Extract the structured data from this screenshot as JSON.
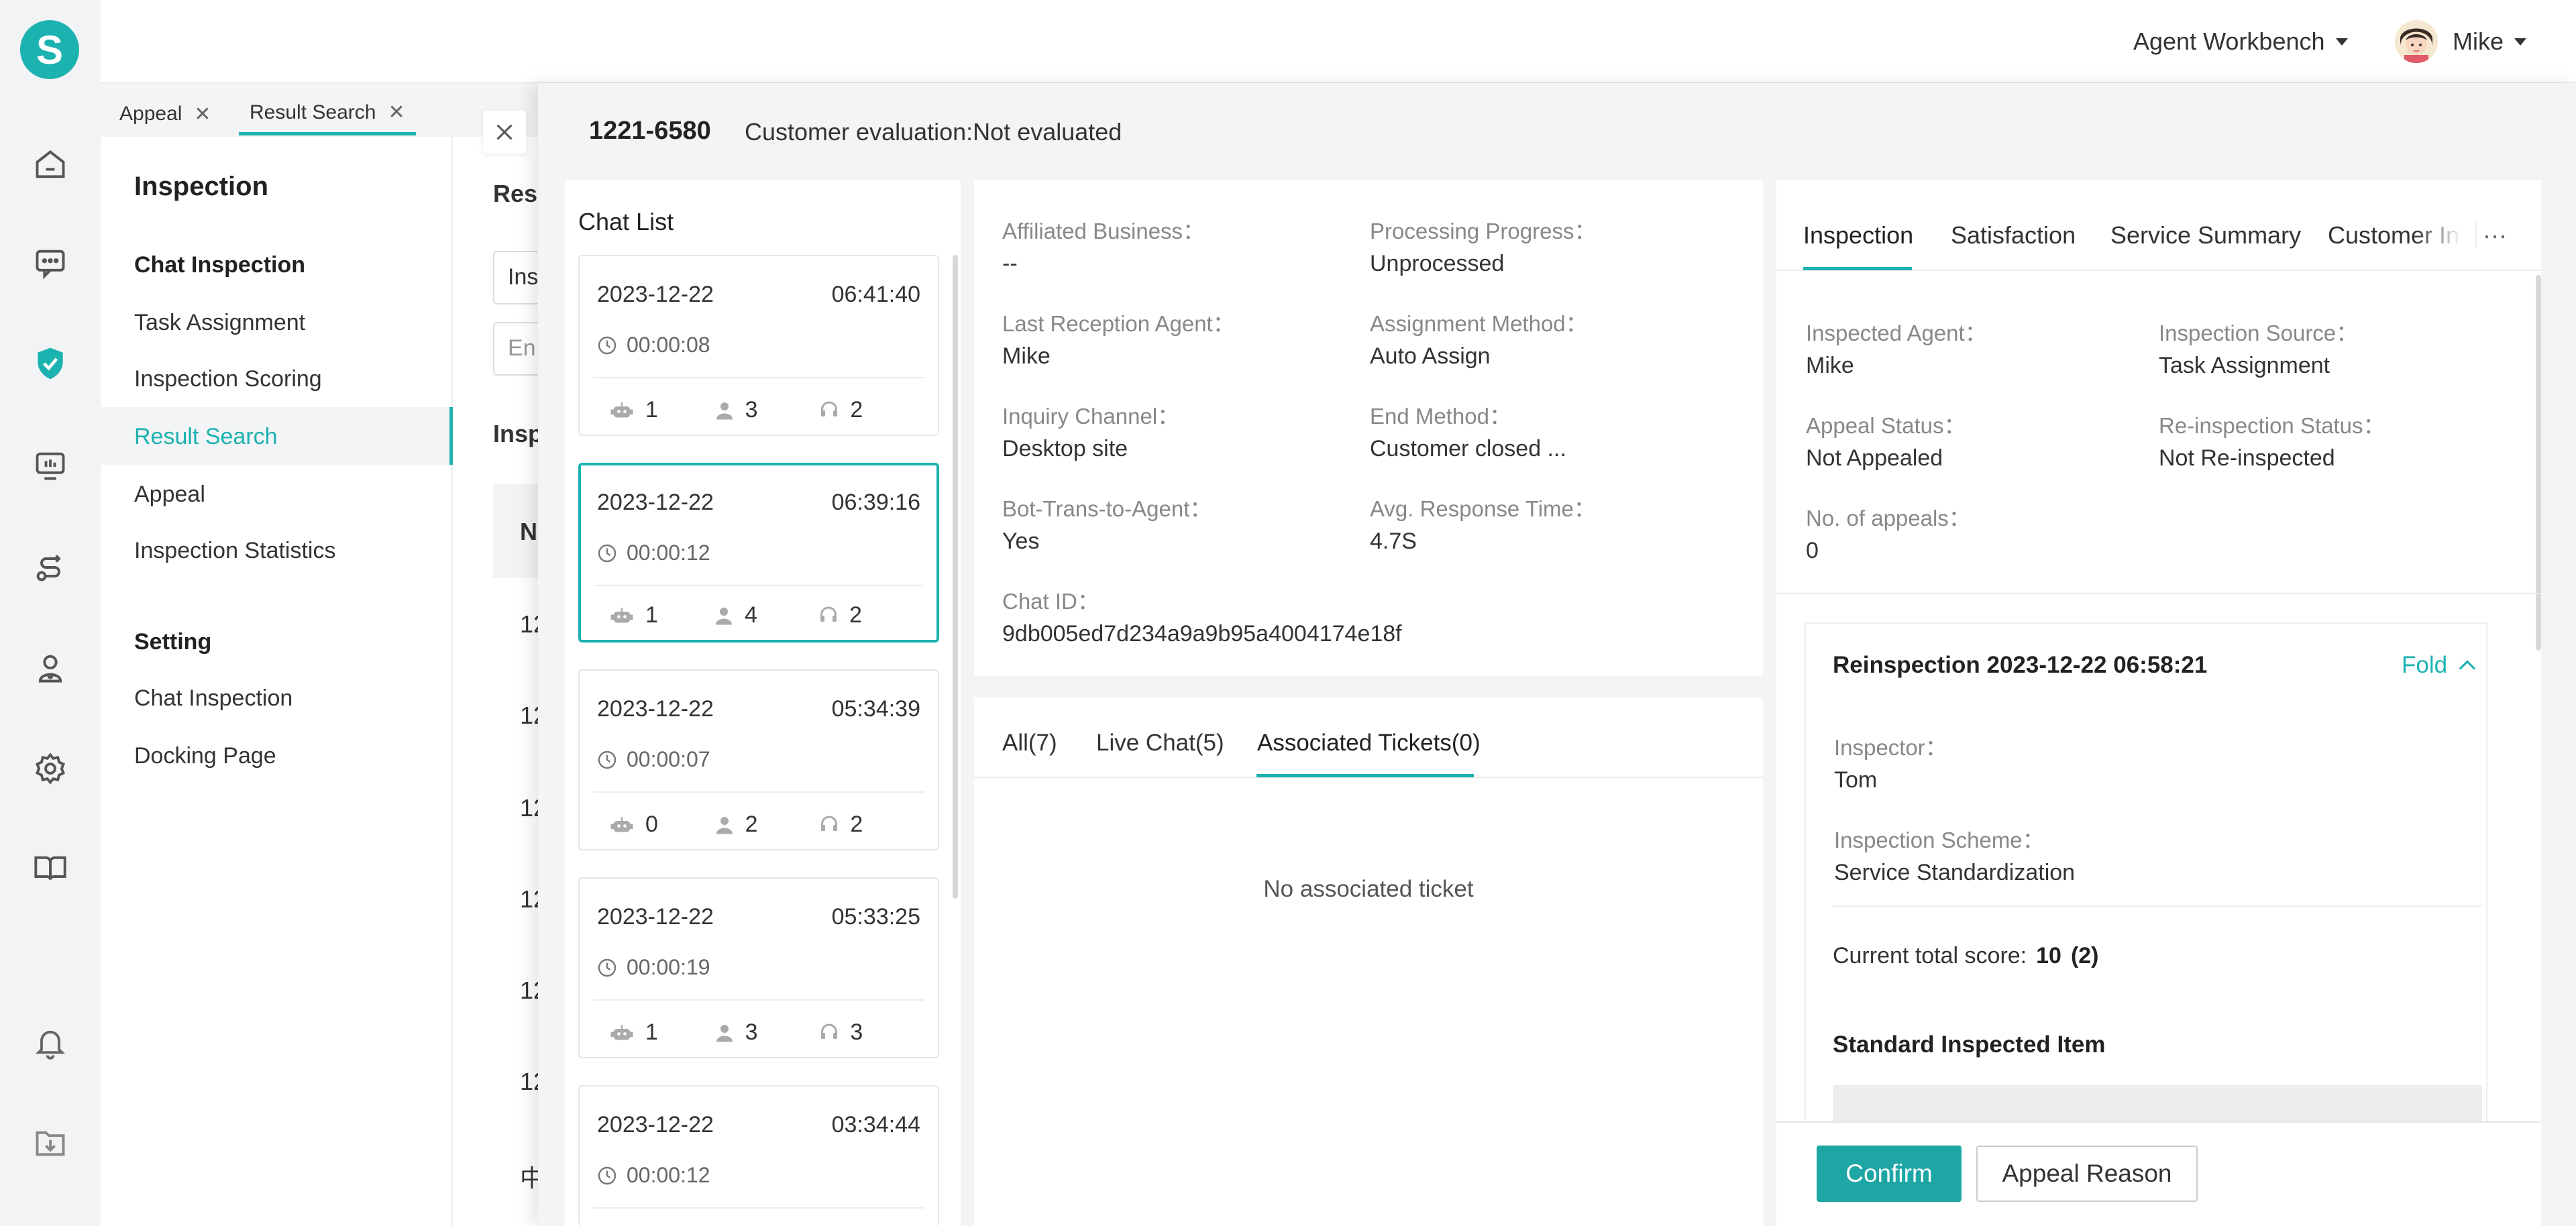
{
  "header": {
    "workbench_label": "Agent Workbench",
    "user_name": "Mike"
  },
  "tabs": [
    {
      "label": "Appeal"
    },
    {
      "label": "Result Search"
    }
  ],
  "sidenav": {
    "title": "Inspection",
    "section1": "Chat Inspection",
    "items1": [
      "Task Assignment",
      "Inspection Scoring",
      "Result Search",
      "Appeal",
      "Inspection Statistics"
    ],
    "section2": "Setting",
    "items2": [
      "Chat Inspection",
      "Docking Page"
    ]
  },
  "bg_page": {
    "title_frag": "Resu",
    "input1_frag": "Ins",
    "input2_frag": "En",
    "section_frag": "Insp",
    "thead_frag": "N",
    "rows": [
      "12",
      "12",
      "12",
      "12",
      "12",
      "12",
      "中"
    ]
  },
  "drawer": {
    "conv_id": "1221-6580",
    "customer_eval": "Customer evaluation:Not evaluated",
    "chat_list_title": "Chat List",
    "chats": [
      {
        "date": "2023-12-22",
        "time": "06:41:40",
        "duration": "00:00:08",
        "bot": "1",
        "visitor": "3",
        "agent": "2"
      },
      {
        "date": "2023-12-22",
        "time": "06:39:16",
        "duration": "00:00:12",
        "bot": "1",
        "visitor": "4",
        "agent": "2"
      },
      {
        "date": "2023-12-22",
        "time": "05:34:39",
        "duration": "00:00:07",
        "bot": "0",
        "visitor": "2",
        "agent": "2"
      },
      {
        "date": "2023-12-22",
        "time": "05:33:25",
        "duration": "00:00:19",
        "bot": "1",
        "visitor": "3",
        "agent": "3"
      },
      {
        "date": "2023-12-22",
        "time": "03:34:44",
        "duration": "00:00:12",
        "bot": "",
        "visitor": "",
        "agent": ""
      }
    ]
  },
  "biz": {
    "affiliated_business_label": "Affiliated Business：",
    "affiliated_business": "--",
    "processing_progress_label": "Processing Progress：",
    "processing_progress": "Unprocessed",
    "last_agent_label": "Last Reception Agent：",
    "last_agent": "Mike",
    "assign_method_label": "Assignment Method：",
    "assign_method": "Auto Assign",
    "inquiry_channel_label": "Inquiry Channel：",
    "inquiry_channel": "Desktop site",
    "end_method_label": "End Method：",
    "end_method": "Customer closed ...",
    "bot_trans_label": "Bot-Trans-to-Agent：",
    "bot_trans": "Yes",
    "avg_resp_label": "Avg. Response Time：",
    "avg_resp": "4.7S",
    "chat_id_label": "Chat ID：",
    "chat_id": "9db005ed7d234a9a9b95a4004174e18f"
  },
  "tickets": {
    "tabs": [
      "All(7)",
      "Live Chat(5)",
      "Associated Tickets(0)"
    ],
    "empty": "No associated ticket"
  },
  "right": {
    "tabs": [
      "Inspection",
      "Satisfaction",
      "Service Summary",
      "Customer Info"
    ],
    "more": "···",
    "inspected_agent_label": "Inspected Agent：",
    "inspected_agent": "Mike",
    "inspection_source_label": "Inspection Source：",
    "inspection_source": "Task Assignment",
    "appeal_status_label": "Appeal Status：",
    "appeal_status": "Not Appealed",
    "reinsp_status_label": "Re-inspection Status：",
    "reinsp_status": "Not Re-inspected",
    "num_appeals_label": "No. of appeals：",
    "num_appeals": "0",
    "reinsp_title": "Reinspection 2023-12-22 06:58:21",
    "fold": "Fold",
    "inspector_label": "Inspector：",
    "inspector": "Tom",
    "scheme_label": "Inspection Scheme：",
    "scheme": "Service Standardization",
    "score_label": "Current total score:",
    "score": "10",
    "score_paren": "(2)",
    "std_item_title": "Standard Inspected Item",
    "confirm": "Confirm",
    "appeal_reason": "Appeal Reason"
  },
  "colors": {
    "accent": "#1bb2b0",
    "confirm_bg": "#1ea6a5"
  }
}
